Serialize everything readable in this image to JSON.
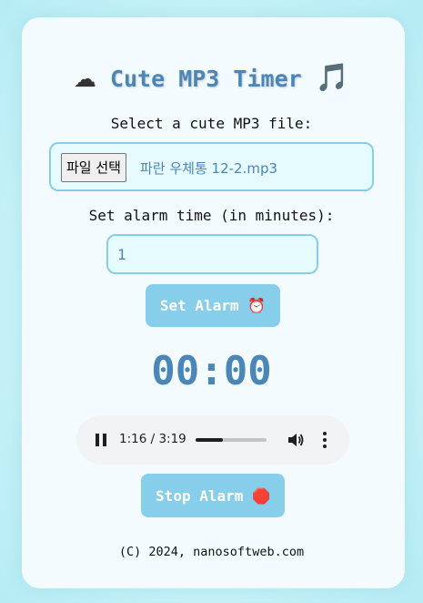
{
  "app": {
    "title_text": "Cute MP3 Timer",
    "cloud_emoji": "☁",
    "note_emoji": "🎵"
  },
  "file": {
    "label": "Select a cute MP3 file:",
    "button_label": "파일 선택",
    "selected_file": "파란 우체통 12-2.mp3"
  },
  "alarm": {
    "label": "Set alarm time (in minutes):",
    "minutes_value": "1",
    "set_button_label": "Set Alarm",
    "set_button_emoji": "⏰",
    "countdown": "00:00",
    "stop_button_label": "Stop Alarm",
    "stop_button_emoji": "🛑"
  },
  "player": {
    "state_icon": "pause-icon",
    "time_display": "1:16 / 3:19",
    "progress_fraction": 0.38,
    "volume_icon": "volume-icon",
    "menu_icon": "more-vert-icon"
  },
  "footer": {
    "copyright": "(C) 2024, nanosoftweb.com"
  },
  "colors": {
    "accent": "#4a86b8",
    "button_bg": "#87ceeb",
    "input_border": "#86cfe6"
  }
}
